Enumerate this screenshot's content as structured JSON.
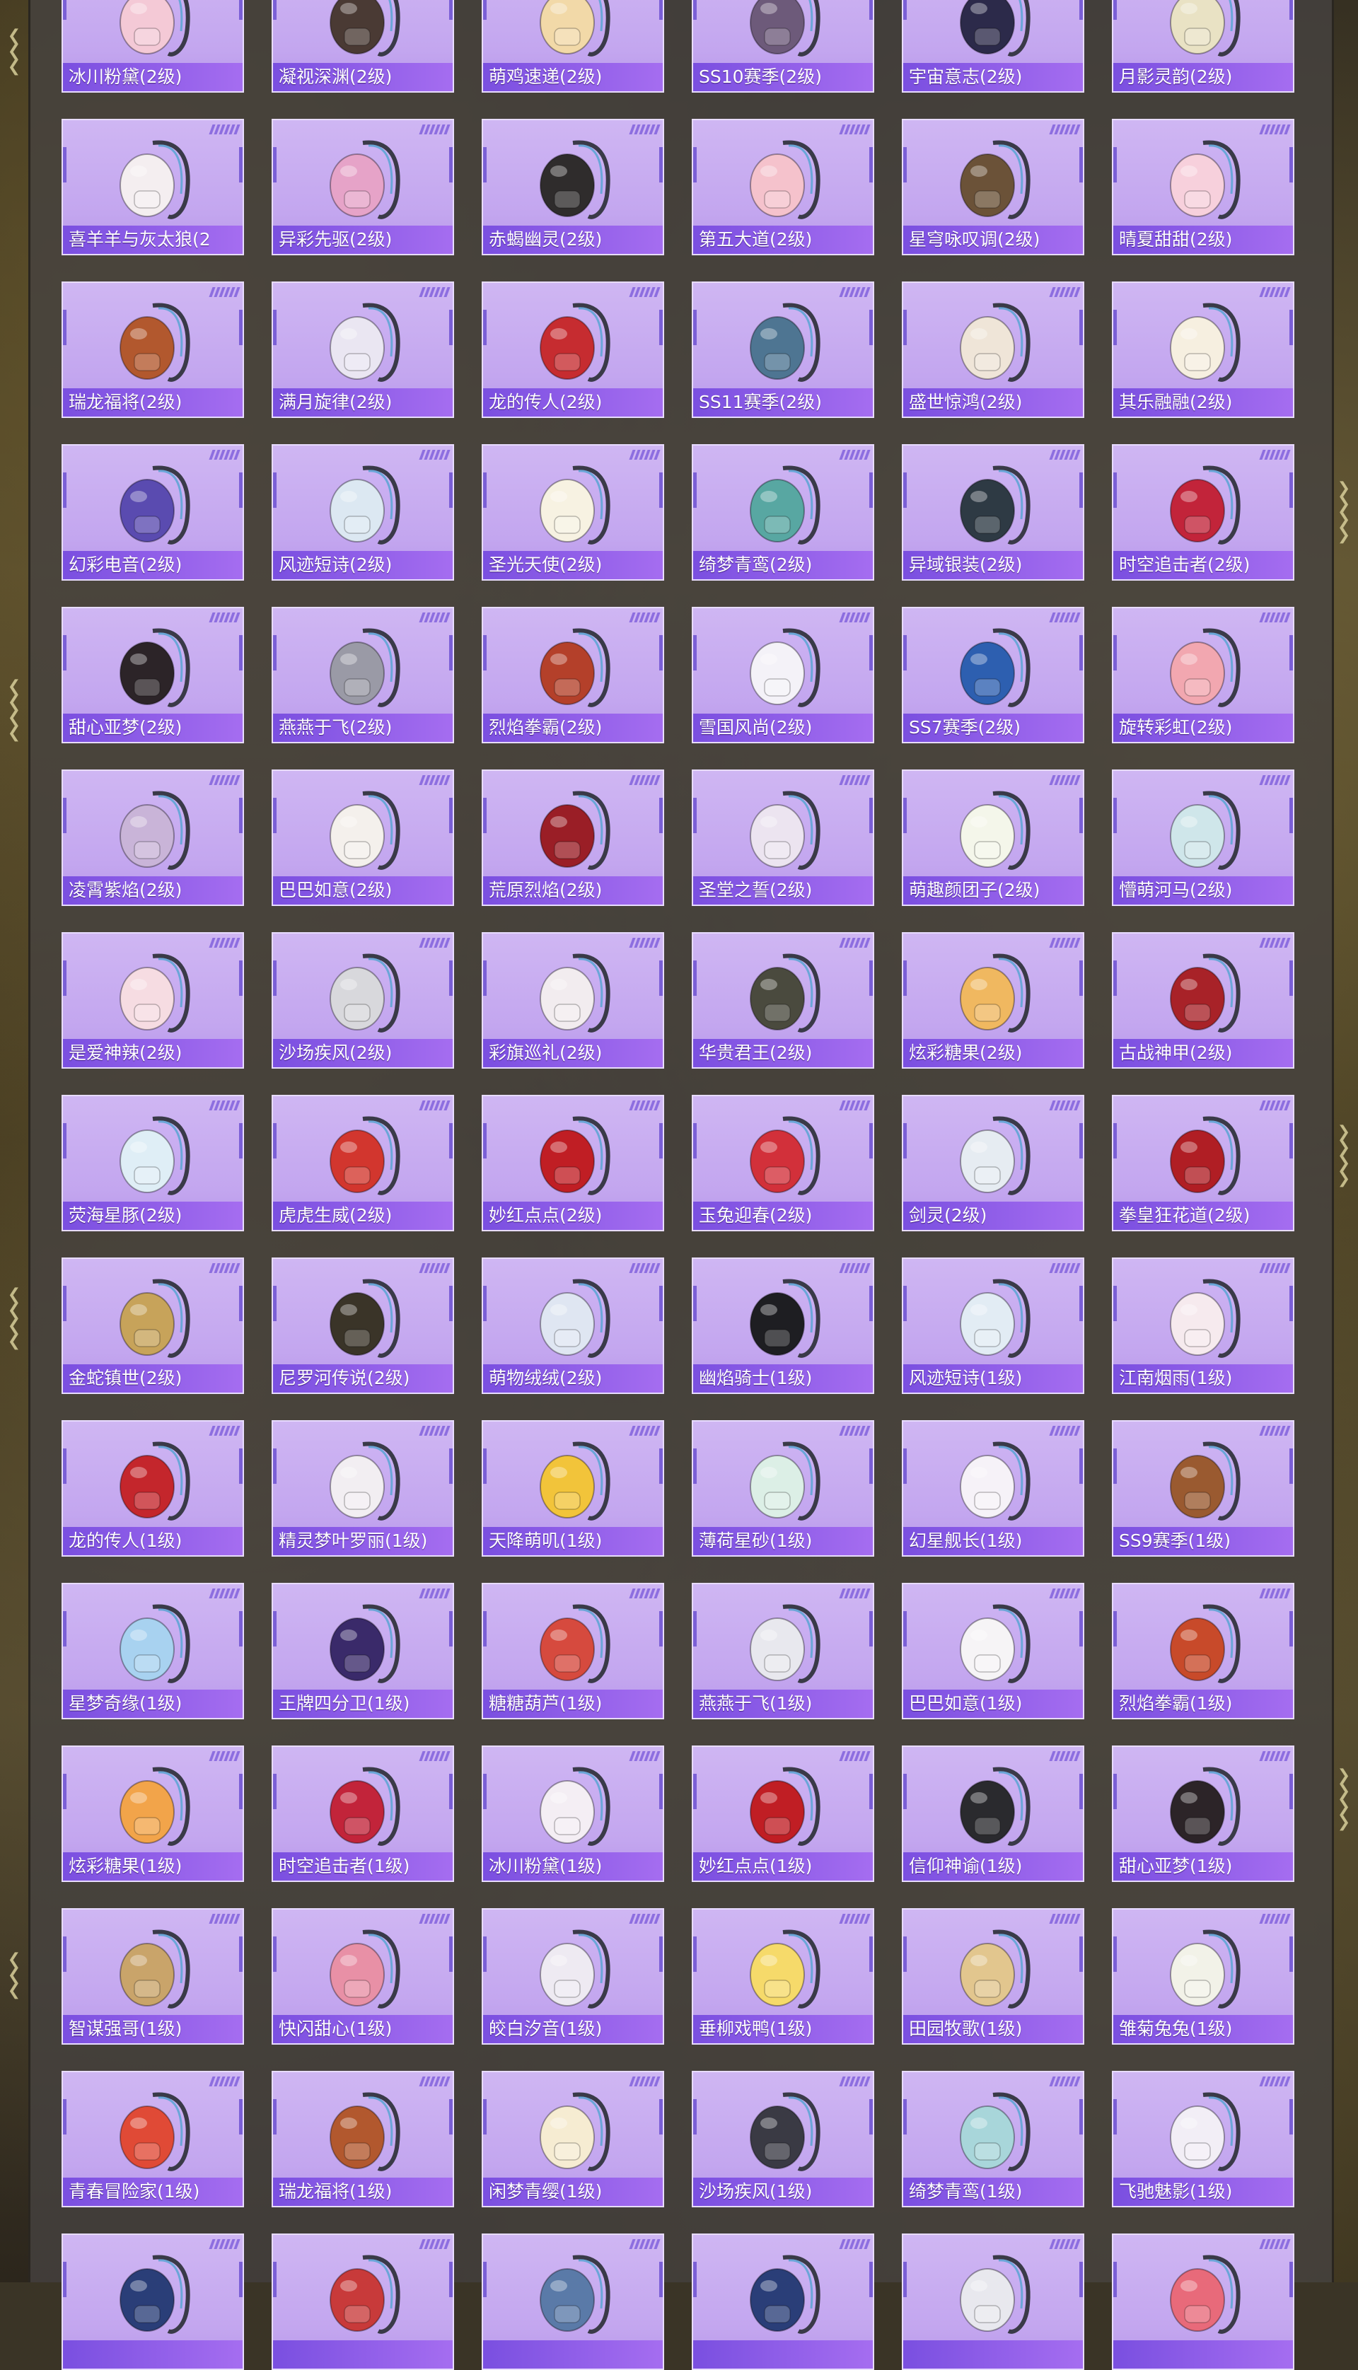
{
  "items": [
    {
      "name": "冰川粉黛(2级)",
      "icon": "backpack-icon",
      "color": "#f4c9d6"
    },
    {
      "name": "凝视深渊(2级)",
      "icon": "backpack-icon",
      "color": "#4a3a34"
    },
    {
      "name": "萌鸡速递(2级)",
      "icon": "backpack-icon",
      "color": "#f2d9a8"
    },
    {
      "name": "SS10赛季(2级)",
      "icon": "backpack-icon",
      "color": "#6d5a7a"
    },
    {
      "name": "宇宙意志(2级)",
      "icon": "backpack-icon",
      "color": "#2c2a4a"
    },
    {
      "name": "月影灵韵(2级)",
      "icon": "backpack-icon",
      "color": "#e9e2c4"
    },
    {
      "name": "喜羊羊与灰太狼(2",
      "icon": "backpack-icon",
      "color": "#f4eef0"
    },
    {
      "name": "异彩先驱(2级)",
      "icon": "backpack-icon",
      "color": "#e6a3c8"
    },
    {
      "name": "赤蝎幽灵(2级)",
      "icon": "backpack-icon",
      "color": "#2f2c2c"
    },
    {
      "name": "第五大道(2级)",
      "icon": "backpack-icon",
      "color": "#f5c2cc"
    },
    {
      "name": "星穹咏叹调(2级)",
      "icon": "backpack-icon",
      "color": "#6b5238"
    },
    {
      "name": "晴夏甜甜(2级)",
      "icon": "backpack-icon",
      "color": "#f7d0dc"
    },
    {
      "name": "瑞龙福将(2级)",
      "icon": "backpack-icon",
      "color": "#b2582e"
    },
    {
      "name": "满月旋律(2级)",
      "icon": "backpack-icon",
      "color": "#eae6f2"
    },
    {
      "name": "龙的传人(2级)",
      "icon": "backpack-icon",
      "color": "#c62c30"
    },
    {
      "name": "SS11赛季(2级)",
      "icon": "backpack-icon",
      "color": "#4e7592"
    },
    {
      "name": "盛世惊鸿(2级)",
      "icon": "backpack-icon",
      "color": "#efe5d8"
    },
    {
      "name": "其乐融融(2级)",
      "icon": "backpack-icon",
      "color": "#f6efe0"
    },
    {
      "name": "幻彩电音(2级)",
      "icon": "backpack-icon",
      "color": "#5a4bb0"
    },
    {
      "name": "风迹短诗(2级)",
      "icon": "backpack-icon",
      "color": "#dce8f2"
    },
    {
      "name": "圣光天使(2级)",
      "icon": "backpack-icon",
      "color": "#f7f2e2"
    },
    {
      "name": "绮梦青鸾(2级)",
      "icon": "backpack-icon",
      "color": "#58a7a2"
    },
    {
      "name": "异域银装(2级)",
      "icon": "backpack-icon",
      "color": "#2e3a44"
    },
    {
      "name": "时空追击者(2级)",
      "icon": "backpack-icon",
      "color": "#c2243a"
    },
    {
      "name": "甜心亚梦(2级)",
      "icon": "backpack-icon",
      "color": "#2c2428"
    },
    {
      "name": "燕燕于飞(2级)",
      "icon": "backpack-icon",
      "color": "#9a9aa6"
    },
    {
      "name": "烈焰拳霸(2级)",
      "icon": "backpack-icon",
      "color": "#b4402a"
    },
    {
      "name": "雪国风尚(2级)",
      "icon": "backpack-icon",
      "color": "#f4f2f8"
    },
    {
      "name": "SS7赛季(2级)",
      "icon": "backpack-icon",
      "color": "#2d5fb0"
    },
    {
      "name": "旋转彩虹(2级)",
      "icon": "backpack-icon",
      "color": "#f2a7b0"
    },
    {
      "name": "凌霄紫焰(2级)",
      "icon": "backpack-icon",
      "color": "#c9b4d8"
    },
    {
      "name": "巴巴如意(2级)",
      "icon": "backpack-icon",
      "color": "#f4f0ec"
    },
    {
      "name": "荒原烈焰(2级)",
      "icon": "backpack-icon",
      "color": "#9a1e26"
    },
    {
      "name": "圣堂之誓(2级)",
      "icon": "backpack-icon",
      "color": "#ece4f0"
    },
    {
      "name": "萌趣颜团子(2级)",
      "icon": "backpack-icon",
      "color": "#f4f6ea"
    },
    {
      "name": "懵萌河马(2级)",
      "icon": "backpack-icon",
      "color": "#cfe6ea"
    },
    {
      "name": "是爱神辣(2级)",
      "icon": "backpack-icon",
      "color": "#f6dce2"
    },
    {
      "name": "沙场疾风(2级)",
      "icon": "backpack-icon",
      "color": "#d8d8dc"
    },
    {
      "name": "彩旗巡礼(2级)",
      "icon": "backpack-icon",
      "color": "#f2ecef"
    },
    {
      "name": "华贵君王(2级)",
      "icon": "backpack-icon",
      "color": "#4a4a3e"
    },
    {
      "name": "炫彩糖果(2级)",
      "icon": "backpack-icon",
      "color": "#f0b860"
    },
    {
      "name": "古战神甲(2级)",
      "icon": "backpack-icon",
      "color": "#a82228"
    },
    {
      "name": "荧海星豚(2级)",
      "icon": "backpack-icon",
      "color": "#dfeef6"
    },
    {
      "name": "虎虎生威(2级)",
      "icon": "backpack-icon",
      "color": "#d2362e"
    },
    {
      "name": "妙红点点(2级)",
      "icon": "backpack-icon",
      "color": "#c01e24"
    },
    {
      "name": "玉兔迎春(2级)",
      "icon": "backpack-icon",
      "color": "#d2303a"
    },
    {
      "name": "剑灵(2级)",
      "icon": "backpack-icon",
      "color": "#e6ecf2"
    },
    {
      "name": "拳皇狂花道(2级)",
      "icon": "backpack-icon",
      "color": "#b01e24"
    },
    {
      "name": "金蛇镇世(2级)",
      "icon": "backpack-icon",
      "color": "#c7a35a"
    },
    {
      "name": "尼罗河传说(2级)",
      "icon": "backpack-icon",
      "color": "#3a3428"
    },
    {
      "name": "萌物绒绒(2级)",
      "icon": "backpack-icon",
      "color": "#dfe6f2"
    },
    {
      "name": "幽焰骑士(1级)",
      "icon": "backpack-icon",
      "color": "#1e1e22"
    },
    {
      "name": "风迹短诗(1级)",
      "icon": "backpack-icon",
      "color": "#e2ecf4"
    },
    {
      "name": "江南烟雨(1级)",
      "icon": "backpack-icon",
      "color": "#f6eaee"
    },
    {
      "name": "龙的传人(1级)",
      "icon": "backpack-icon",
      "color": "#c4262c"
    },
    {
      "name": "精灵梦叶罗丽(1级)",
      "icon": "backpack-icon",
      "color": "#f2eef2"
    },
    {
      "name": "天降萌叽(1级)",
      "icon": "backpack-icon",
      "color": "#f2c43a"
    },
    {
      "name": "薄荷星砂(1级)",
      "icon": "backpack-icon",
      "color": "#dcefe6"
    },
    {
      "name": "幻星舰长(1级)",
      "icon": "backpack-icon",
      "color": "#f6f2f8"
    },
    {
      "name": "SS9赛季(1级)",
      "icon": "backpack-icon",
      "color": "#9a5a30"
    },
    {
      "name": "星梦奇缘(1级)",
      "icon": "backpack-icon",
      "color": "#a8d2f0"
    },
    {
      "name": "王牌四分卫(1级)",
      "icon": "backpack-icon",
      "color": "#3a2a6a"
    },
    {
      "name": "糖糖葫芦(1级)",
      "icon": "backpack-icon",
      "color": "#d64a3e"
    },
    {
      "name": "燕燕于飞(1级)",
      "icon": "backpack-icon",
      "color": "#e8e8ee"
    },
    {
      "name": "巴巴如意(1级)",
      "icon": "backpack-icon",
      "color": "#f6f4f6"
    },
    {
      "name": "烈焰拳霸(1级)",
      "icon": "backpack-icon",
      "color": "#c84a2a"
    },
    {
      "name": "炫彩糖果(1级)",
      "icon": "backpack-icon",
      "color": "#f2a44a"
    },
    {
      "name": "时空追击者(1级)",
      "icon": "backpack-icon",
      "color": "#c2243a"
    },
    {
      "name": "冰川粉黛(1级)",
      "icon": "backpack-icon",
      "color": "#f4eef4"
    },
    {
      "name": "妙红点点(1级)",
      "icon": "backpack-icon",
      "color": "#c01e24"
    },
    {
      "name": "信仰神谕(1级)",
      "icon": "backpack-icon",
      "color": "#2a2a2e"
    },
    {
      "name": "甜心亚梦(1级)",
      "icon": "backpack-icon",
      "color": "#2c2428"
    },
    {
      "name": "智谋强哥(1级)",
      "icon": "backpack-icon",
      "color": "#c9a46a"
    },
    {
      "name": "快闪甜心(1级)",
      "icon": "backpack-icon",
      "color": "#e890a6"
    },
    {
      "name": "皎白汐音(1级)",
      "icon": "backpack-icon",
      "color": "#eeeaf2"
    },
    {
      "name": "垂柳戏鸭(1级)",
      "icon": "backpack-icon",
      "color": "#f6da6a"
    },
    {
      "name": "田园牧歌(1级)",
      "icon": "backpack-icon",
      "color": "#e2c68e"
    },
    {
      "name": "雏菊兔兔(1级)",
      "icon": "backpack-icon",
      "color": "#f2f2e8"
    },
    {
      "name": "青春冒险家(1级)",
      "icon": "backpack-icon",
      "color": "#e04a36"
    },
    {
      "name": "瑞龙福将(1级)",
      "icon": "backpack-icon",
      "color": "#b2582e"
    },
    {
      "name": "闲梦青缨(1级)",
      "icon": "backpack-icon",
      "color": "#f6ecd2"
    },
    {
      "name": "沙场疾风(1级)",
      "icon": "backpack-icon",
      "color": "#3a3a44"
    },
    {
      "name": "绮梦青鸾(1级)",
      "icon": "backpack-icon",
      "color": "#a8d6da"
    },
    {
      "name": "飞驰魅影(1级)",
      "icon": "backpack-icon",
      "color": "#f2eef6"
    },
    {
      "name": "",
      "icon": "backpack-icon",
      "color": "#2a3e78"
    },
    {
      "name": "",
      "icon": "backpack-icon",
      "color": "#c83a3a"
    },
    {
      "name": "",
      "icon": "backpack-icon",
      "color": "#5a7aa8"
    },
    {
      "name": "",
      "icon": "backpack-icon",
      "color": "#2a3e78"
    },
    {
      "name": "",
      "icon": "backpack-icon",
      "color": "#e8e8ee"
    },
    {
      "name": "",
      "icon": "backpack-icon",
      "color": "#e86a7a"
    }
  ],
  "colors": {
    "card_bg": "#c3a6ef",
    "label_bg": "#8a5ae6",
    "panel_bg": "#46423f",
    "accent": "#7b5fd6"
  }
}
